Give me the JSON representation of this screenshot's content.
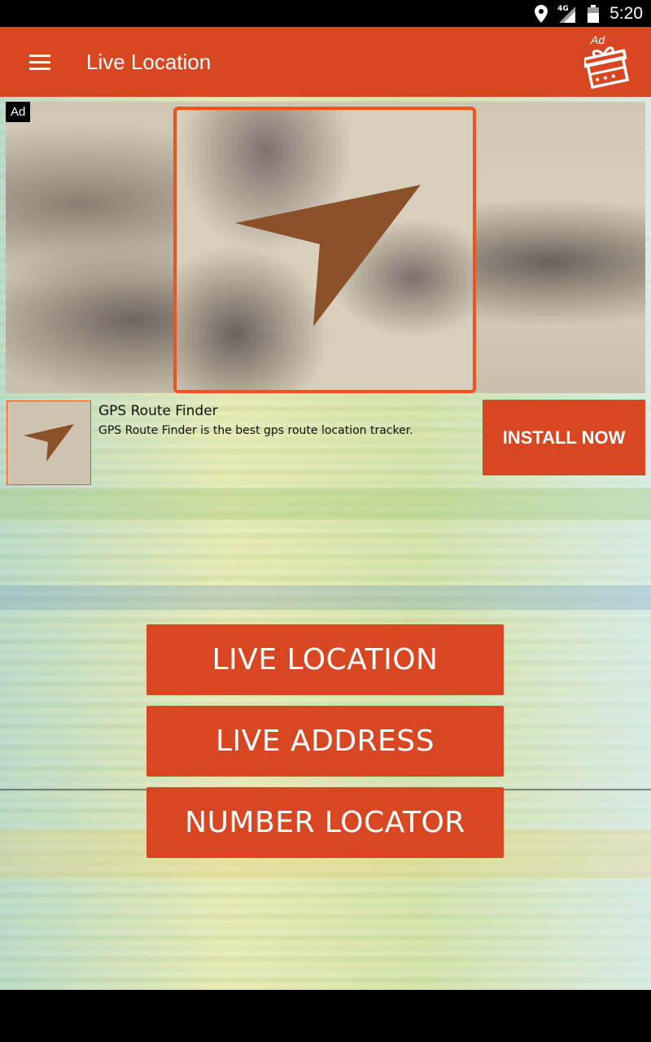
{
  "status_bar": {
    "network": "4G",
    "time": "5:20"
  },
  "app_bar": {
    "title": "Live Location",
    "gift_ad_label": "Ad"
  },
  "ad": {
    "tag": "Ad",
    "app_name": "GPS Route Finder",
    "description": "GPS Route Finder is the best gps route location tracker.",
    "install_label": "INSTALL NOW"
  },
  "buttons": {
    "live_location": "LIVE LOCATION",
    "live_address": "LIVE ADDRESS",
    "number_locator": "NUMBER LOCATOR"
  },
  "colors": {
    "primary": "#d84722",
    "ad_border": "#f05220",
    "arrow": "#8b5229"
  }
}
